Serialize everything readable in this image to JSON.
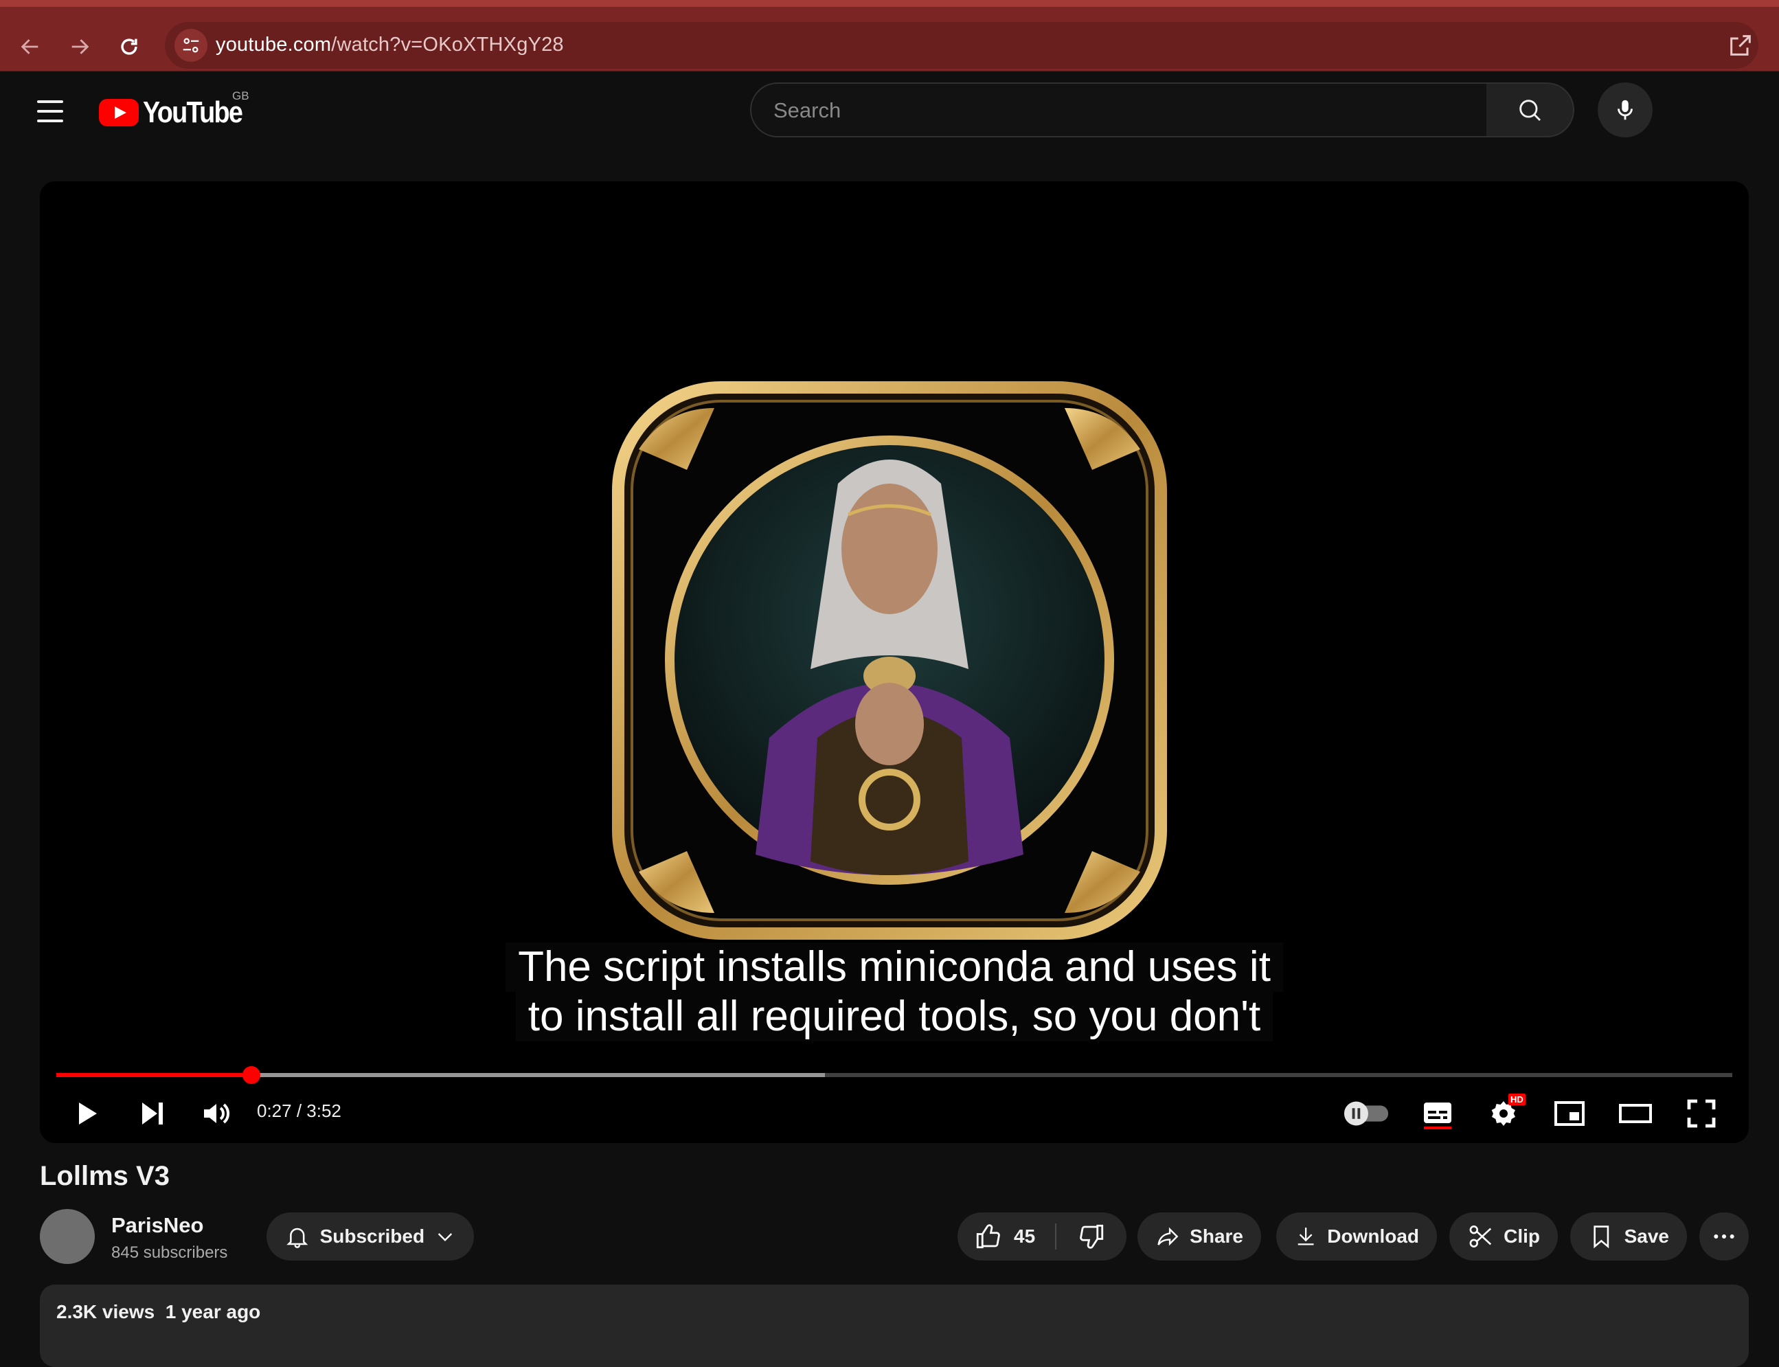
{
  "browser": {
    "url_host": "youtube.com",
    "url_path": "/watch?v=OKoXTHXgY28"
  },
  "masthead": {
    "logo_text": "YouTube",
    "region": "GB",
    "search_placeholder": "Search"
  },
  "player": {
    "caption_line1": "The script installs miniconda and uses it",
    "caption_line2": "to install all required tools, so you don't",
    "time_display": "0:27 / 3:52",
    "progress_played_fraction": 0.1164,
    "progress_buffered_fraction": 0.4588,
    "settings_badge": "HD"
  },
  "video": {
    "title": "Lollms V3",
    "channel_name": "ParisNeo",
    "subscribers": "845 subscribers",
    "subscribe_label": "Subscribed",
    "like_count": "45",
    "share_label": "Share",
    "download_label": "Download",
    "clip_label": "Clip",
    "save_label": "Save",
    "views_meta": "2.3K views  1 year ago"
  },
  "colors": {
    "browser_bar": "#7b2525",
    "accent_red": "#ff0000",
    "page_bg": "#0f0f0f",
    "chip_bg": "#272727"
  },
  "icons": [
    "back-arrow-icon",
    "forward-arrow-icon",
    "reload-icon",
    "site-settings-icon",
    "open-in-new-icon",
    "menu-icon",
    "search-icon",
    "mic-icon",
    "play-icon",
    "next-icon",
    "volume-icon",
    "autoplay-toggle-icon",
    "subtitles-icon",
    "settings-gear-icon",
    "miniplayer-icon",
    "theater-icon",
    "fullscreen-icon",
    "bell-icon",
    "chevron-down-icon",
    "thumbs-up-icon",
    "thumbs-down-icon",
    "share-icon",
    "download-icon",
    "scissors-icon",
    "bookmark-icon",
    "more-horiz-icon"
  ]
}
